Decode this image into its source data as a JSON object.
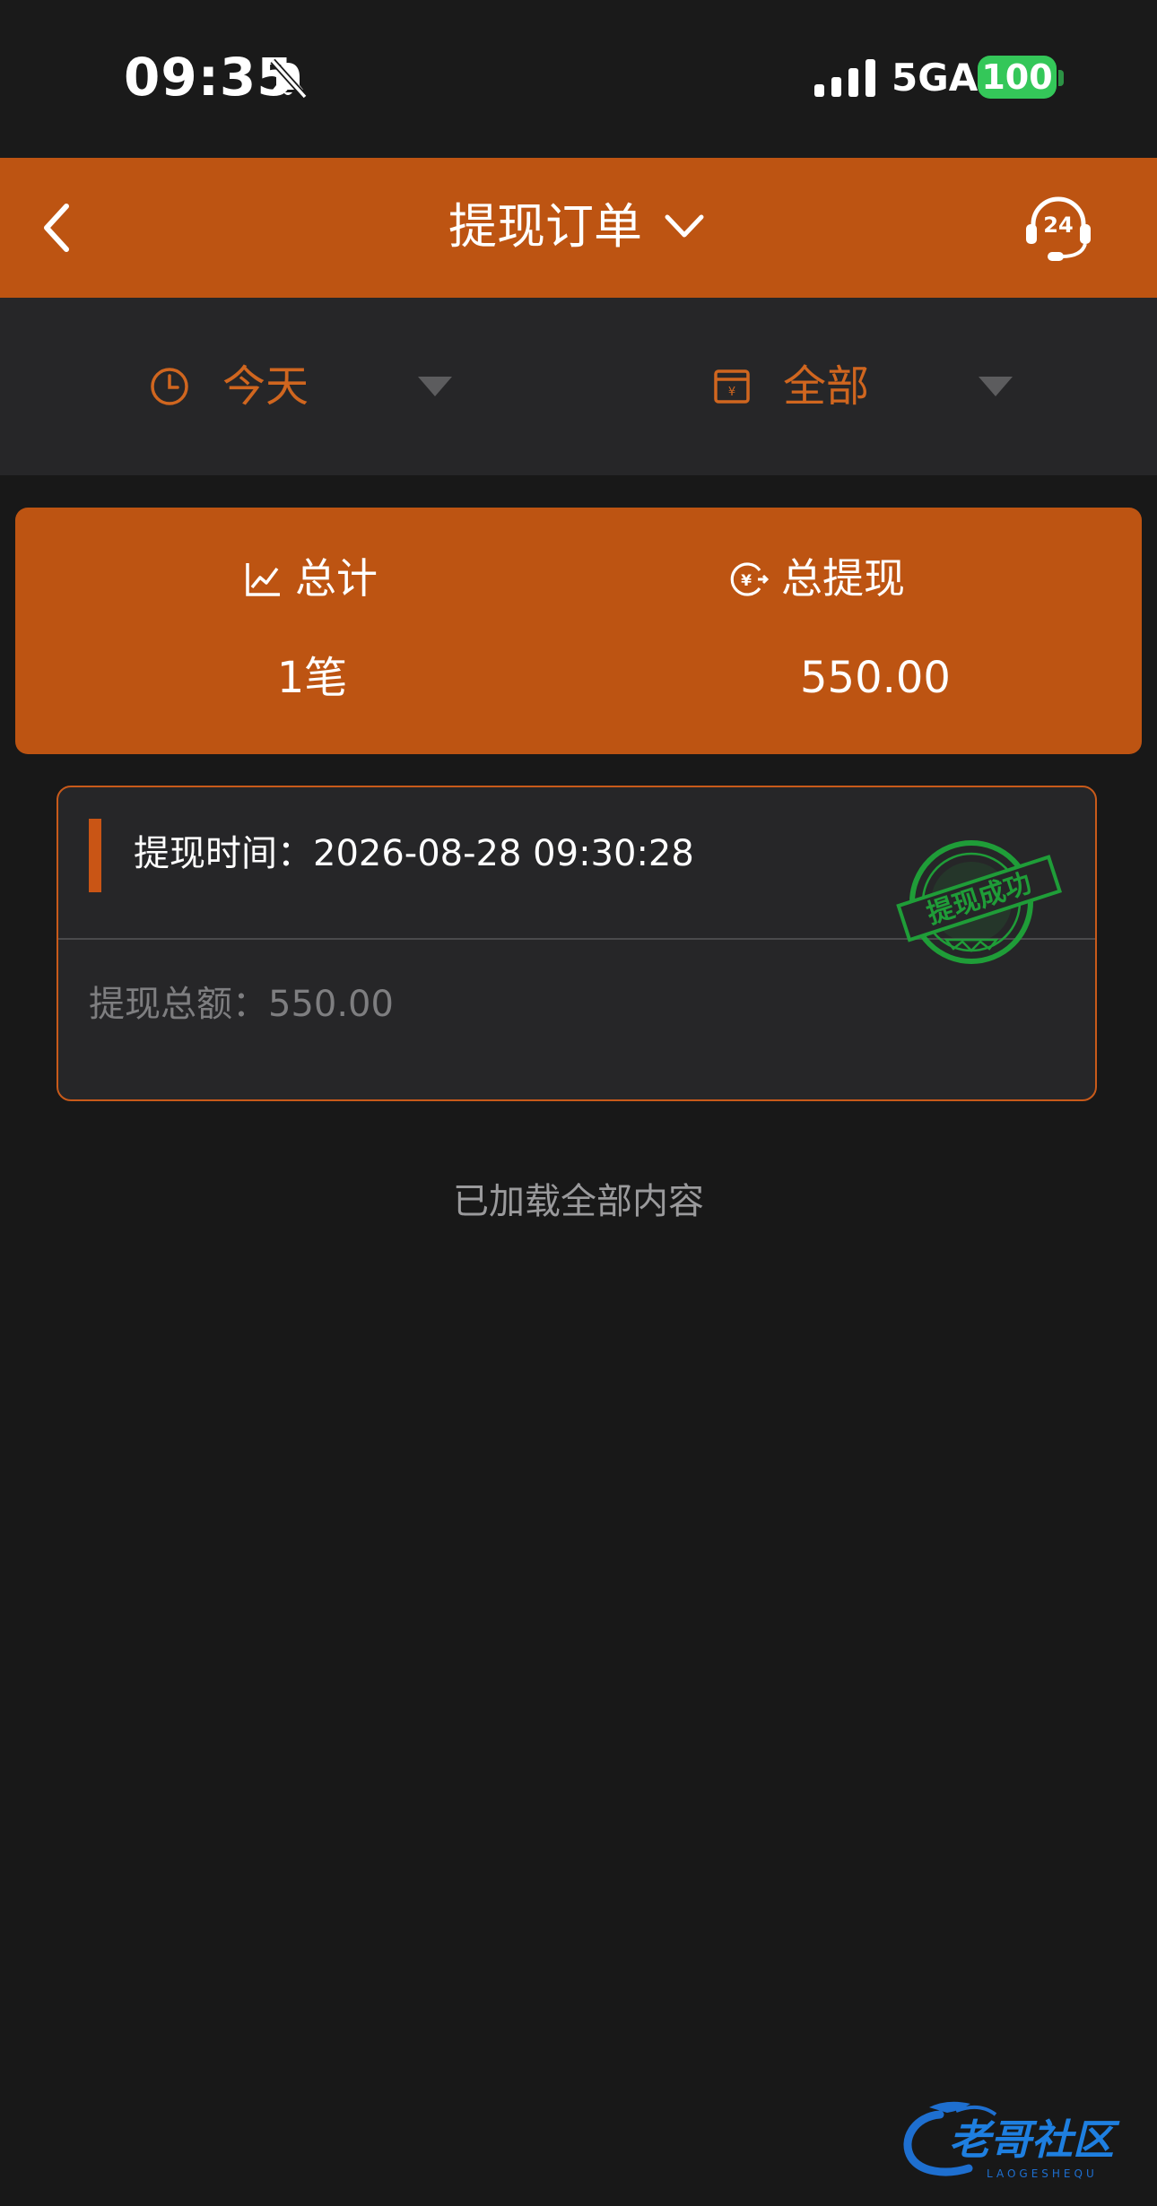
{
  "status_bar": {
    "time": "09:35",
    "network": "5GA",
    "battery": "100",
    "mute_icon": "bell-slash-icon",
    "signal_icon": "signal-bars-icon"
  },
  "nav": {
    "title": "提现订单",
    "back_icon": "chevron-left-icon",
    "title_dropdown_icon": "chevron-down-icon",
    "support_icon": "headset-24-icon",
    "support_badge": "24"
  },
  "filters": [
    {
      "label": "今天",
      "icon": "clock-icon"
    },
    {
      "label": "全部",
      "icon": "box-icon"
    }
  ],
  "summary": {
    "total_label": "总计",
    "total_value": "1笔",
    "total_icon": "chart-line-icon",
    "withdraw_label": "总提现",
    "withdraw_value": "550.00",
    "withdraw_icon": "yuan-arrow-icon"
  },
  "orders": [
    {
      "time_label": "提现时间",
      "time_value": "2026-08-28 09:30:28",
      "time_text": "提现时间：2026-08-28 09:30:28",
      "amount_text": "提现总额：550.00",
      "stamp_text": "提现成功"
    }
  ],
  "footer": {
    "loaded_text": "已加载全部内容"
  },
  "watermark": {
    "text": "老哥社区",
    "subtext": "LAOGESHEQU"
  },
  "colors": {
    "accent": "#bd5412",
    "background": "#181818",
    "panel": "#262628",
    "filter_text": "#d0661f",
    "stamp": "#1fa83a",
    "battery": "#34c759"
  }
}
